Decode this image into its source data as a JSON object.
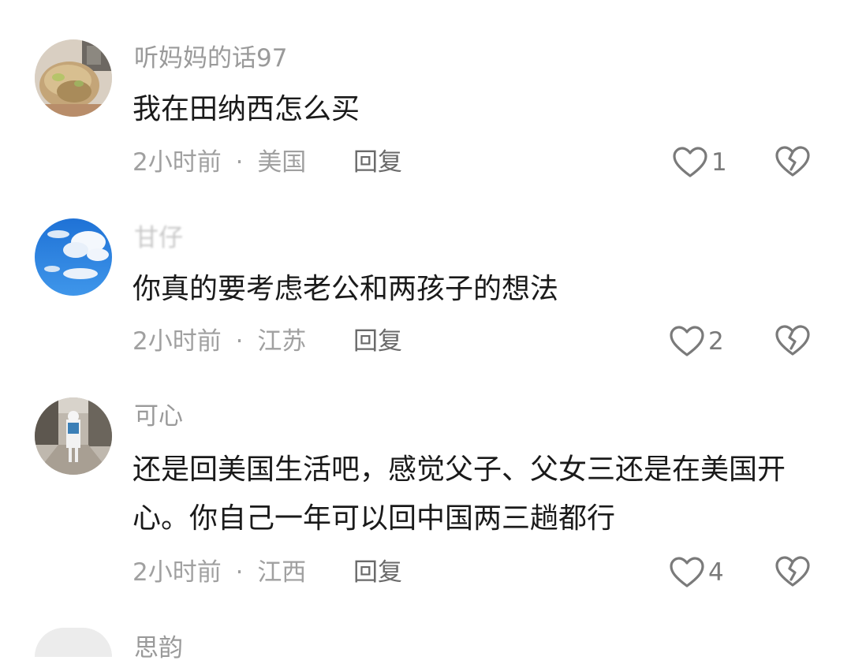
{
  "comments": [
    {
      "username": "听妈妈的话97",
      "text": "我在田纳西怎么买",
      "time": "2小时前",
      "location": "美国",
      "reply_label": "回复",
      "like_count": "1"
    },
    {
      "username": "甘仔",
      "text": "你真的要考虑老公和两孩子的想法",
      "time": "2小时前",
      "location": "江苏",
      "reply_label": "回复",
      "like_count": "2"
    },
    {
      "username": "可心",
      "text": "还是回美国生活吧，感觉父子、父女三还是在美国开心。你自己一年可以回中国两三趟都行",
      "time": "2小时前",
      "location": "江西",
      "reply_label": "回复",
      "like_count": "4"
    },
    {
      "username": "思韵"
    }
  ],
  "separator": "·",
  "icons": {
    "like": "heart-outline-icon",
    "dislike": "broken-heart-icon"
  },
  "colors": {
    "username": "#9a9a9a",
    "text": "#1a1a1a",
    "meta": "#a0a0a0",
    "icon": "#7a7a7a"
  }
}
